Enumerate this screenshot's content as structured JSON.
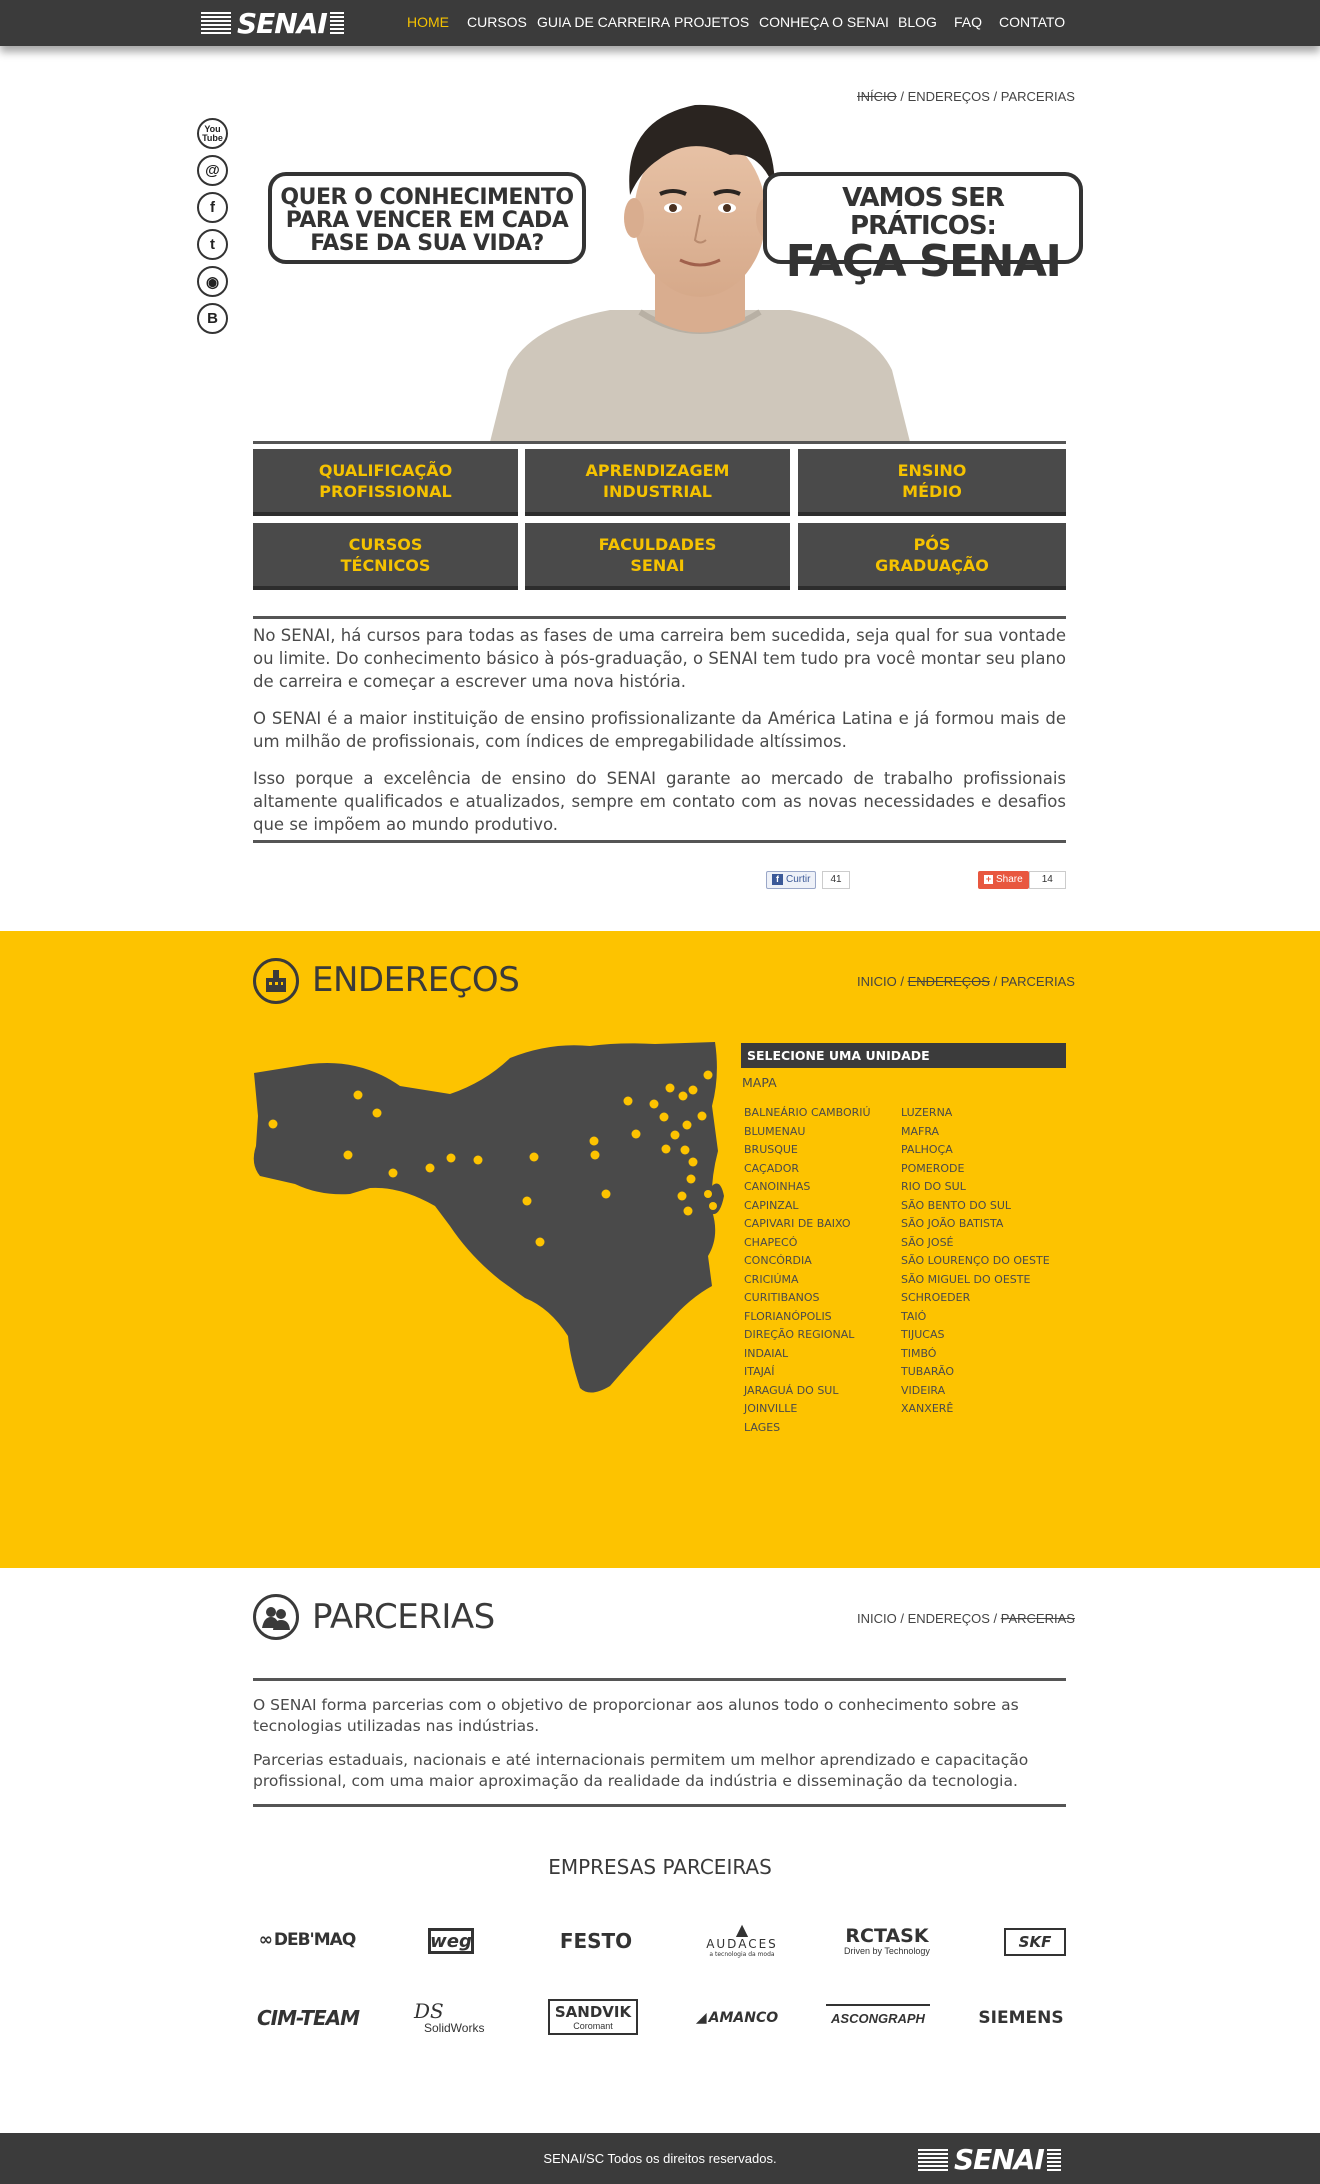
{
  "nav": {
    "logo": "SENAI",
    "items": [
      {
        "label": "HOME",
        "active": true
      },
      {
        "label": "CURSOS"
      },
      {
        "label": "GUIA DE CARREIRA"
      },
      {
        "label": "PROJETOS"
      },
      {
        "label": "CONHEÇA O SENAI"
      },
      {
        "label": "BLOG"
      },
      {
        "label": "FAQ"
      },
      {
        "label": "CONTATO"
      }
    ]
  },
  "breadcrumb": {
    "inicio": "INÍCIO",
    "enderecos": "ENDEREÇOS",
    "parcerias": "PARCERIAS",
    "sep": " / "
  },
  "breadcrumb2": {
    "inicio": "INICIO"
  },
  "social": [
    "YouTube",
    "Orkut",
    "Facebook",
    "Twitter",
    "Flickr",
    "Blogger"
  ],
  "hero": {
    "bubble_left": [
      "QUER O CONHECIMENTO",
      "PARA VENCER EM CADA",
      "FASE DA SUA VIDA?"
    ],
    "bubble_right_l1": "VAMOS SER PRÁTICOS:",
    "bubble_right_l2": "FAÇA SENAI"
  },
  "buttons": [
    [
      "QUALIFICAÇÃO",
      "PROFISSIONAL"
    ],
    [
      "APRENDIZAGEM",
      "INDUSTRIAL"
    ],
    [
      "ENSINO",
      "MÉDIO"
    ],
    [
      "CURSOS",
      "TÉCNICOS"
    ],
    [
      "FACULDADES",
      "SENAI"
    ],
    [
      "PÓS",
      "GRADUAÇÃO"
    ]
  ],
  "intro": [
    "No SENAI, há cursos para todas as fases de uma carreira bem sucedida, seja qual for sua vontade ou limite. Do conhecimento básico à pós-graduação, o SENAI tem tudo pra você montar seu plano de carreira e começar a escrever uma nova história.",
    "O SENAI é a maior instituição de ensino profissionalizante da América Latina e já formou mais de um milhão de profissionais, com índices de empregabilidade altíssimos.",
    "Isso porque a excelência de ensino do SENAI garante ao mercado de trabalho profissionais altamente qualificados e atualizados, sempre em contato com as novas necessidades e desafios que se impõem ao mundo produtivo."
  ],
  "share": {
    "curtir": "Curtir",
    "curtir_count": "41",
    "share": "Share",
    "share_count": "14"
  },
  "enderecos": {
    "title": "ENDEREÇOS",
    "select_label": "SELECIONE UMA UNIDADE",
    "map_label": "MAPA",
    "col1": [
      "BALNEÁRIO CAMBORIÚ",
      "BLUMENAU",
      "BRUSQUE",
      "CAÇADOR",
      "CANOINHAS",
      "CAPINZAL",
      "CAPIVARI DE BAIXO",
      "CHAPECÓ",
      "CONCÓRDIA",
      "CRICIÚMA",
      "CURITIBANOS",
      "FLORIANÓPOLIS",
      "DIREÇÃO REGIONAL",
      "INDAIAL",
      "ITAJAÍ",
      "JARAGUÁ DO SUL",
      "JOINVILLE",
      "LAGES"
    ],
    "col2": [
      "LUZERNA",
      "MAFRA",
      "PALHOÇA",
      "POMERODE",
      "RIO DO SUL",
      "SÃO BENTO DO SUL",
      "SÃO JOÃO BATISTA",
      "SÃO JOSÉ",
      "SÃO LOURENÇO DO OESTE",
      "SÃO MIGUEL DO OESTE",
      "SCHROEDER",
      "TAIÓ",
      "TIJUCAS",
      "TIMBÓ",
      "TUBARÃO",
      "VIDEIRA",
      "XANXERÊ"
    ]
  },
  "parcerias": {
    "title": "PARCERIAS",
    "text": [
      "O SENAI forma parcerias com o objetivo de proporcionar aos alunos todo o conhecimento sobre as tecnologias utilizadas nas indústrias.",
      "Parcerias estaduais, nacionais e até internacionais permitem um melhor aprendizado e capacitação profissional, com uma maior aproximação da realidade da indústria e disseminação da tecnologia."
    ],
    "empresas_title": "EMPRESAS PARCEIRAS",
    "logos": [
      "DEB'MAQ",
      "weg",
      "FESTO",
      "AUDACES",
      "RCTASK",
      "SKF",
      "CIM-TEAM",
      "SolidWorks",
      "SANDVIK",
      "AMANCO",
      "ASCONGRAPH",
      "SIEMENS"
    ],
    "logo_subs": {
      "audaces": "a tecnologia da moda",
      "rctask": "Driven by Technology",
      "sandvik": "Coromant",
      "ds": "DS"
    }
  },
  "footer": {
    "copyright": "SENAI/SC Todos os direitos reservados.",
    "logo": "SENAI"
  },
  "colors": {
    "yellow": "#fdc300",
    "dark": "#3b3b3b",
    "accent": "#f5c200"
  }
}
